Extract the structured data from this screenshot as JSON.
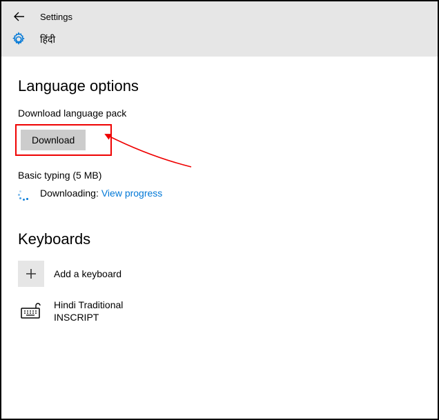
{
  "header": {
    "app_title": "Settings",
    "language_name": "हिंदी"
  },
  "main": {
    "section1_title": "Language options",
    "download_label": "Download language pack",
    "download_button": "Download",
    "basic_typing": "Basic typing (5 MB)",
    "downloading_text": "Downloading:",
    "view_progress": "View progress",
    "section2_title": "Keyboards",
    "add_keyboard": "Add a keyboard",
    "keyboard_name_line1": "Hindi Traditional",
    "keyboard_name_line2": "INSCRIPT"
  }
}
